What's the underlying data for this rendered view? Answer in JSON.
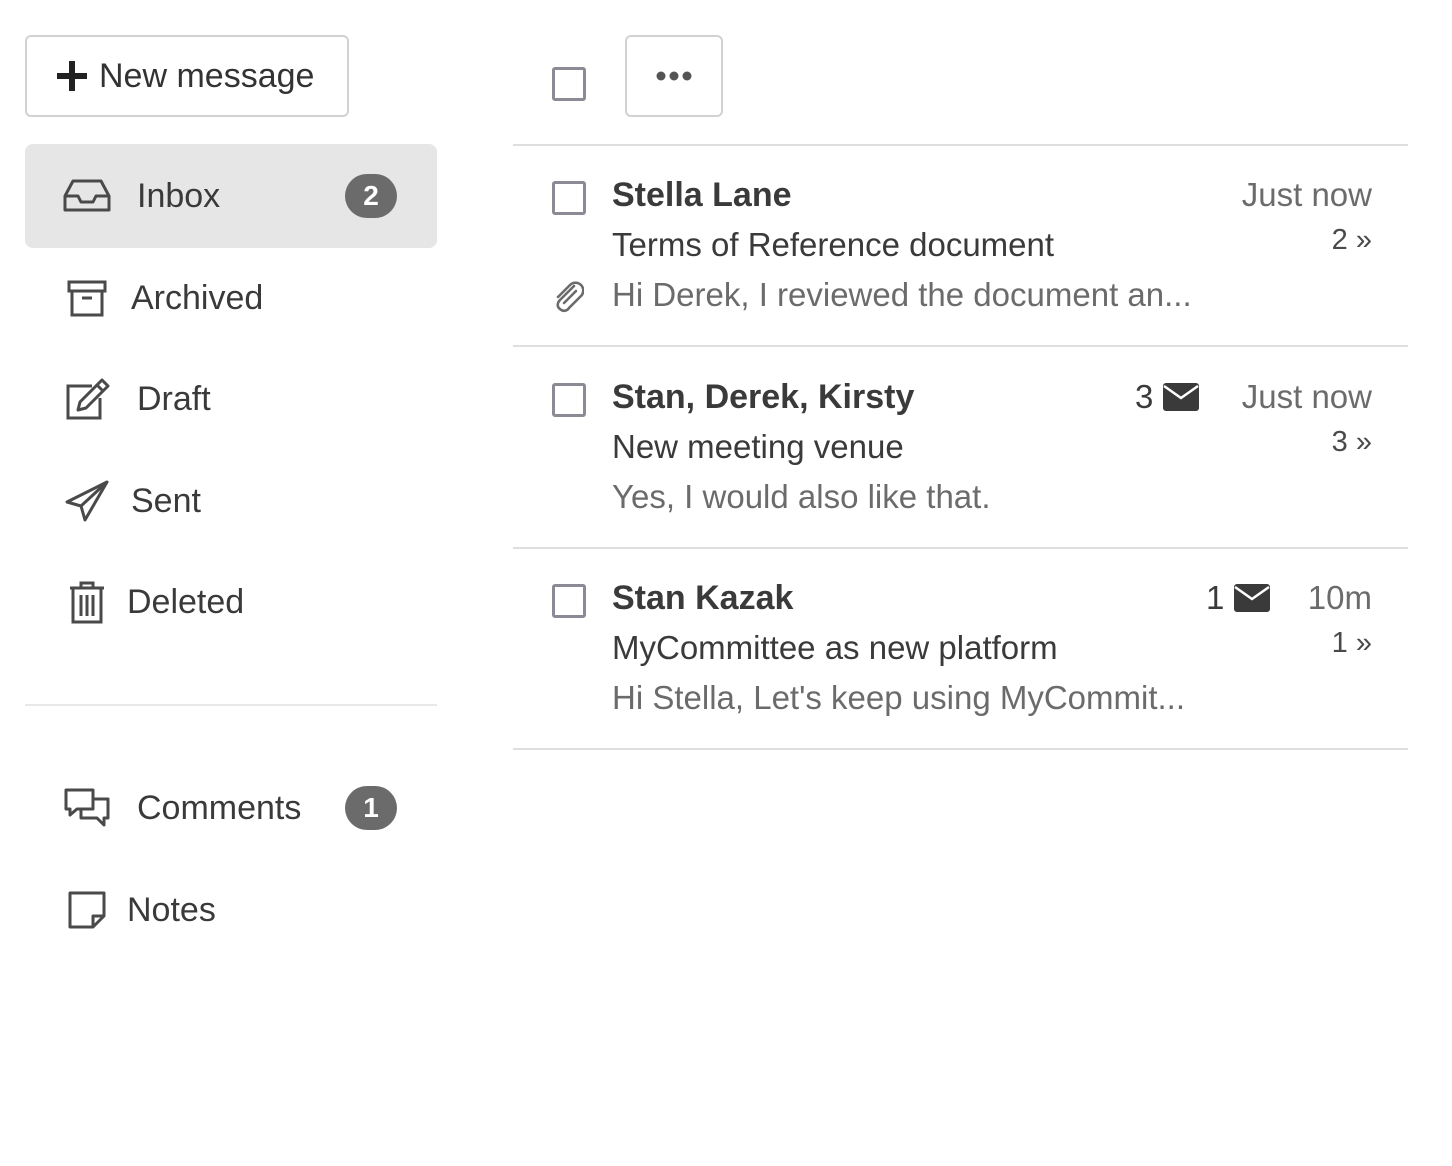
{
  "sidebar": {
    "new_message_label": "New message",
    "folders": [
      {
        "label": "Inbox",
        "icon": "inbox-icon",
        "badge": "2",
        "active": true
      },
      {
        "label": "Archived",
        "icon": "archive-icon"
      },
      {
        "label": "Draft",
        "icon": "edit-icon"
      },
      {
        "label": "Sent",
        "icon": "send-icon"
      },
      {
        "label": "Deleted",
        "icon": "trash-icon"
      }
    ],
    "extras": [
      {
        "label": "Comments",
        "icon": "comments-icon",
        "badge": "1"
      },
      {
        "label": "Notes",
        "icon": "note-icon"
      }
    ]
  },
  "toolbar": {
    "more_icon": "ellipsis-icon"
  },
  "messages": [
    {
      "sender": "Stella Lane",
      "subject": "Terms of Reference document",
      "preview": "Hi Derek, I reviewed the document an...",
      "time": "Just now",
      "thread_count": "2 »",
      "has_attachment": true
    },
    {
      "sender": "Stan, Derek, Kirsty",
      "subject": "New meeting venue",
      "preview": "Yes, I would also like that.",
      "time": "Just now",
      "thread_count": "3 »",
      "unread_count": "3"
    },
    {
      "sender": "Stan Kazak",
      "subject": "MyCommittee as new platform",
      "preview": "Hi Stella, Let's keep using MyCommit...",
      "time": "10m",
      "thread_count": "1 »",
      "unread_count": "1"
    }
  ],
  "colors": {
    "active_bg": "#e6e6e6",
    "badge_bg": "#6b6b6b",
    "checkbox_border": "#8b8b96",
    "muted_text": "#6b6b6b"
  }
}
